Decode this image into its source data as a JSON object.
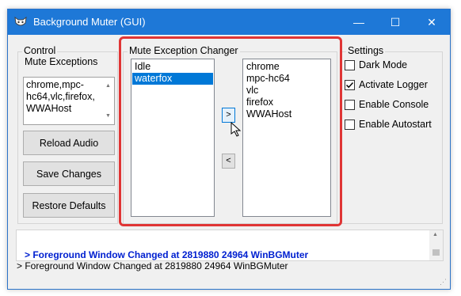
{
  "window": {
    "title": "Background Muter (GUI)",
    "minimize": "—",
    "maximize": "☐",
    "close": "✕"
  },
  "control": {
    "group_title": "Control",
    "mute_exceptions_label": "Mute Exceptions",
    "mute_exceptions_value": "chrome,mpc-hc64,vlc,firefox,WWAHost",
    "reload_button": "Reload Audio",
    "save_button": "Save Changes",
    "restore_button": "Restore Defaults"
  },
  "changer": {
    "group_title": "Mute Exception Changer",
    "left_list": [
      {
        "label": "Idle",
        "selected": false
      },
      {
        "label": "waterfox",
        "selected": true
      }
    ],
    "right_list": [
      "chrome",
      "mpc-hc64",
      "vlc",
      "firefox",
      "WWAHost"
    ],
    "add_button": ">",
    "remove_button": "<"
  },
  "settings": {
    "group_title": "Settings",
    "options": [
      {
        "label": "Dark Mode",
        "checked": false
      },
      {
        "label": "Activate Logger",
        "checked": true
      },
      {
        "label": "Enable Console",
        "checked": false
      },
      {
        "label": "Enable Autostart",
        "checked": false
      }
    ]
  },
  "log": {
    "line": "> Foreground Window Changed at 2819880 24964 WinBGMuter"
  },
  "status_bar": {
    "text": "> Foreground Window Changed at 2819880 24964 WinBGMuter"
  },
  "colors": {
    "title_bar": "#1e78d7",
    "selection": "#0078d7",
    "highlight": "#e03535",
    "log_text": "#0020d0"
  }
}
